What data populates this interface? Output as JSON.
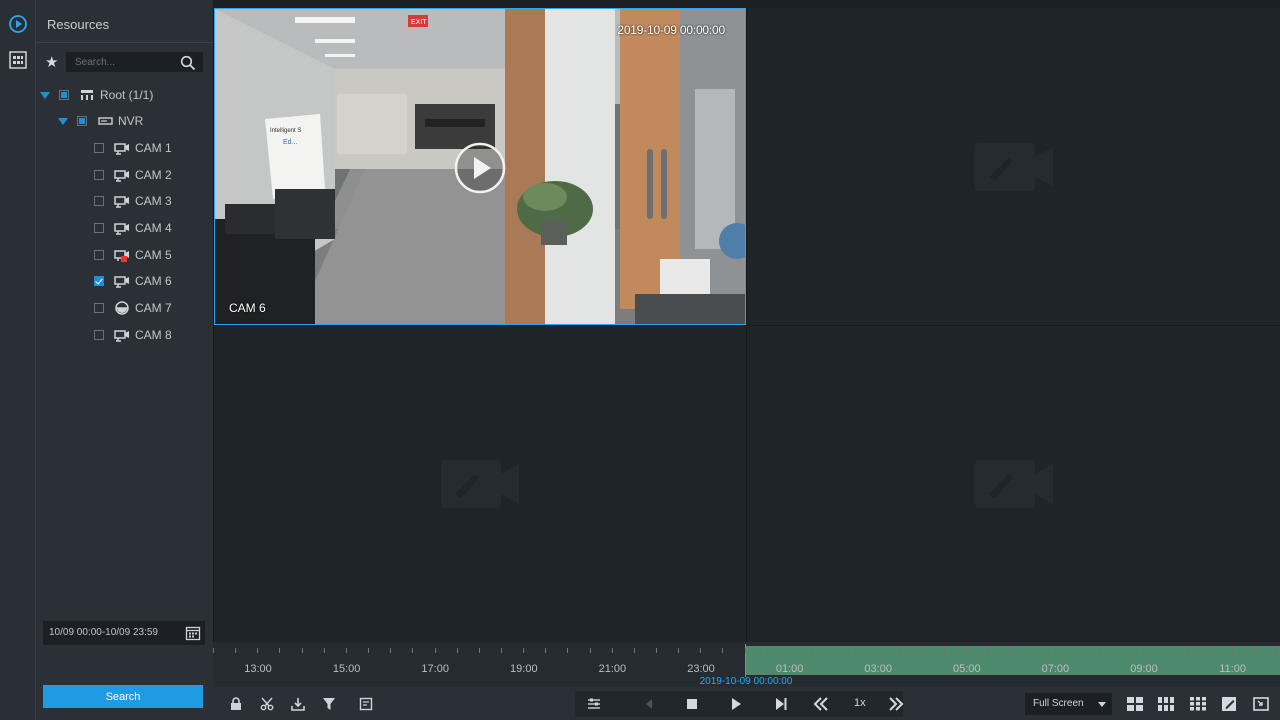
{
  "app": {
    "accent": "#1e9be3",
    "background": "#1b1f23"
  },
  "sidebar": {
    "title": "Resources",
    "search_placeholder": "Search...",
    "tree": {
      "root": {
        "label": "Root (1/1)",
        "state": "partial"
      },
      "nvr": {
        "label": "NVR",
        "state": "partial"
      },
      "cameras": [
        {
          "label": "CAM 1",
          "checked": false,
          "icon": "camera-icon"
        },
        {
          "label": "CAM 2",
          "checked": false,
          "icon": "camera-icon"
        },
        {
          "label": "CAM 3",
          "checked": false,
          "icon": "camera-icon"
        },
        {
          "label": "CAM 4",
          "checked": false,
          "icon": "camera-icon"
        },
        {
          "label": "CAM 5",
          "checked": false,
          "icon": "camera-offline-icon"
        },
        {
          "label": "CAM 6",
          "checked": true,
          "icon": "camera-icon"
        },
        {
          "label": "CAM 7",
          "checked": false,
          "icon": "dome-camera-icon"
        },
        {
          "label": "CAM 8",
          "checked": false,
          "icon": "camera-icon"
        }
      ]
    },
    "date_range": "10/09 00:00-10/09 23:59",
    "search_button": "Search"
  },
  "video": {
    "active": {
      "camera_label": "CAM 6",
      "timestamp": "2019-10-09 00:00:00",
      "sign_text": "EXIT",
      "whiteboard_line1": "Intelligent S",
      "whiteboard_line2": "Ed..."
    }
  },
  "timeline": {
    "labels": [
      "13:00",
      "15:00",
      "17:00",
      "19:00",
      "21:00",
      "23:00",
      "01:00",
      "03:00",
      "05:00",
      "07:00",
      "09:00",
      "11:00"
    ],
    "cursor_time": "2019-10-09 00:00:00",
    "recorded_color": "#4d8a6c"
  },
  "toolbar": {
    "speed": "1x",
    "window_mode": "Full Screen",
    "left_tools": [
      "lock-icon",
      "clip-icon",
      "download-icon",
      "filter-icon",
      "snapshot-list-icon"
    ],
    "playback_tools": [
      "menu-icon",
      "prev-frame-icon",
      "stop-icon",
      "play-icon",
      "next-frame-icon",
      "slow-icon",
      "fast-icon"
    ],
    "layout_tools": [
      "layout-4-icon",
      "layout-6-icon",
      "layout-9-icon",
      "edit-icon",
      "exit-fullscreen-icon"
    ]
  }
}
